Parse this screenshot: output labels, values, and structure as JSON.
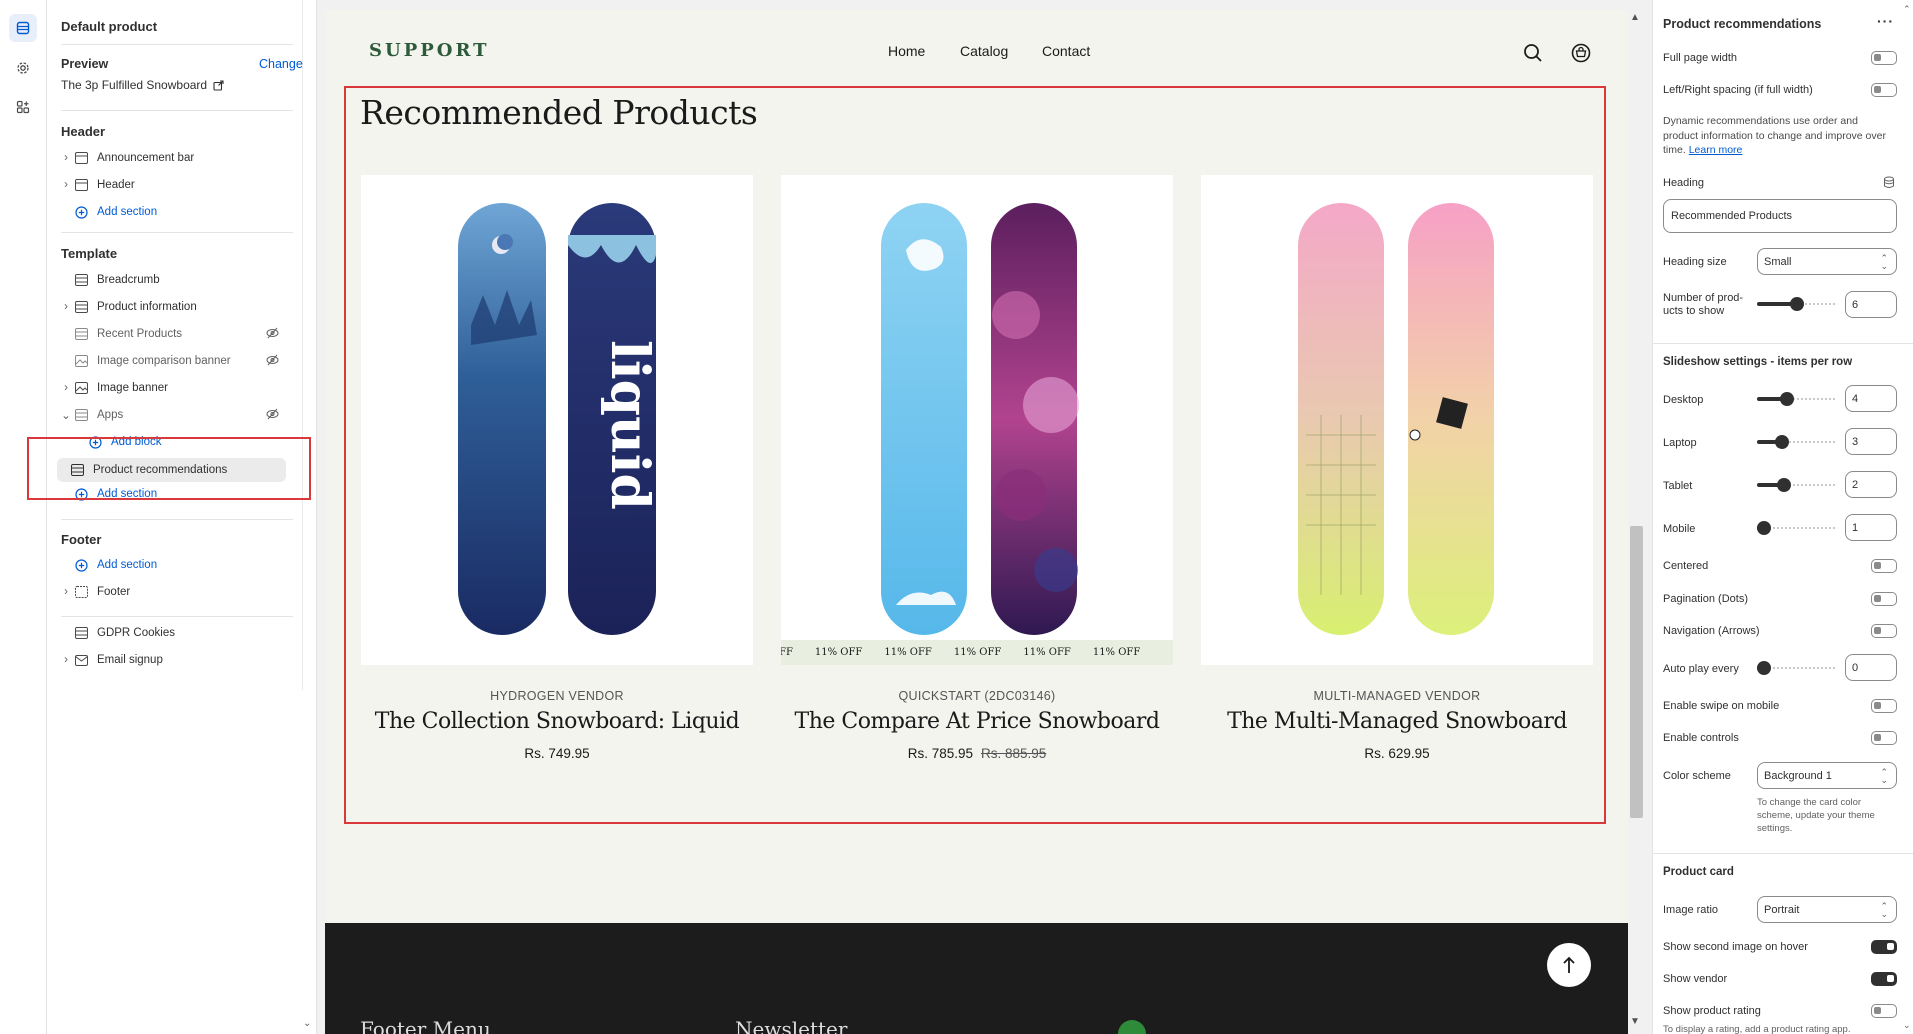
{
  "left_panel": {
    "title": "Default product",
    "preview_label": "Preview",
    "change_label": "Change",
    "preview_value": "The 3p Fulfilled Snowboard",
    "header_section": "Header",
    "header_items": [
      "Announcement bar",
      "Header"
    ],
    "add_section": "Add section",
    "template_section": "Template",
    "template_items": [
      "Breadcrumb",
      "Product information",
      "Recent Products",
      "Image comparison banner",
      "Image banner",
      "Apps"
    ],
    "add_block": "Add block",
    "selected_item": "Product recommendations",
    "footer_section": "Footer",
    "footer_items": [
      "Footer"
    ],
    "extra_items": [
      "GDPR Cookies",
      "Email signup"
    ]
  },
  "store": {
    "logo": "SUPPORT",
    "nav": [
      "Home",
      "Catalog",
      "Contact"
    ],
    "section_title": "Recommended Products",
    "marquee_text": "11% OFF",
    "marquee_partial": "FF",
    "products": [
      {
        "vendor": "HYDROGEN VENDOR",
        "name": "The Collection Snowboard: Liquid",
        "price": "Rs. 749.95",
        "compare_price": ""
      },
      {
        "vendor": "QUICKSTART (2DC03146)",
        "name": "The Compare At Price Snowboard",
        "price": "Rs. 785.95",
        "compare_price": "Rs. 885.95"
      },
      {
        "vendor": "MULTI-MANAGED VENDOR",
        "name": "The Multi-Managed Snowboard",
        "price": "Rs. 629.95",
        "compare_price": ""
      }
    ],
    "footer_menu": "Footer Menu",
    "footer_newsletter": "Newsletter"
  },
  "right_panel": {
    "title": "Product recommendations",
    "full_page_width": "Full page width",
    "lr_spacing": "Left/Right spacing (if full width)",
    "info_text": "Dynamic recommendations use order and product information to change and improve over time.",
    "learn_more": "Learn more",
    "heading_label": "Heading",
    "heading_value": "Recommended Products",
    "heading_size_label": "Heading size",
    "heading_size_value": "Small",
    "num_products_label_1": "Number of prod-",
    "num_products_label_2": "ucts to show",
    "num_products_value": "6",
    "num_products_level": 0.5,
    "slideshow_heading": "Slideshow settings - items per row",
    "desktop_label": "Desktop",
    "desktop_value": "4",
    "desktop_level": 0.35,
    "laptop_label": "Laptop",
    "laptop_value": "3",
    "laptop_level": 0.27,
    "tablet_label": "Tablet",
    "tablet_value": "2",
    "tablet_level": 0.3,
    "mobile_label": "Mobile",
    "mobile_value": "1",
    "mobile_level": 0,
    "centered": "Centered",
    "pagination": "Pagination (Dots)",
    "navigation": "Navigation (Arrows)",
    "autoplay_label": "Auto play every",
    "autoplay_value": "0",
    "autoplay_level": 0,
    "swipe": "Enable swipe on mobile",
    "controls": "Enable controls",
    "color_scheme_label": "Color scheme",
    "color_scheme_value": "Background 1",
    "color_scheme_help": "To change the card color scheme, update your theme settings.",
    "product_card_heading": "Product card",
    "image_ratio_label": "Image ratio",
    "image_ratio_value": "Portrait",
    "second_image": "Show second image on hover",
    "show_vendor": "Show vendor",
    "show_rating": "Show product rating",
    "rating_help": "To display a rating, add a product rating app."
  },
  "colors": {
    "accent": "#005bd3",
    "highlight": "#d9393b",
    "store_bg": "#f3f4ee",
    "footer_bg": "#1c1c1c"
  }
}
